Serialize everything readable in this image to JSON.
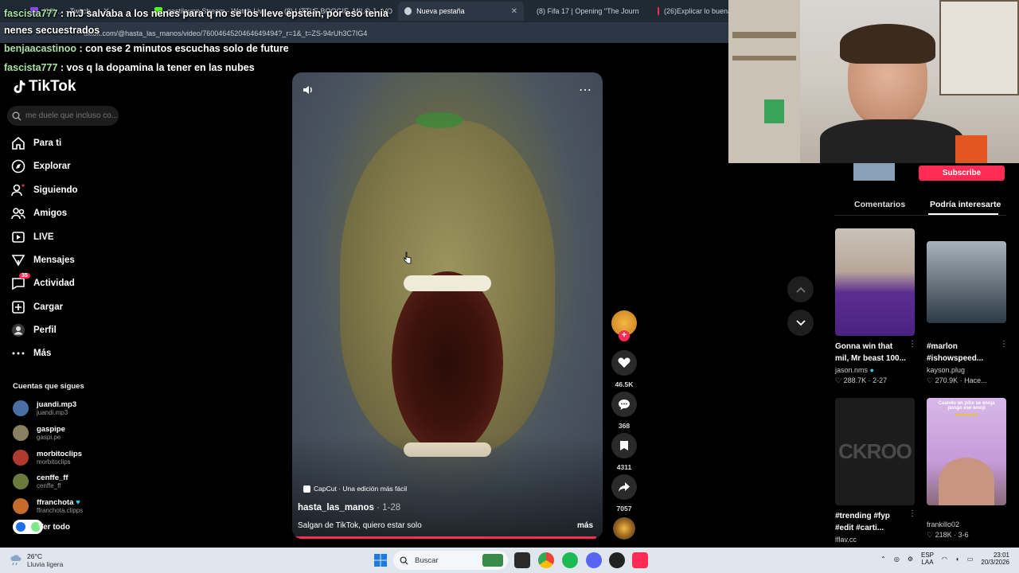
{
  "browser": {
    "tabs": [
      {
        "label": "(19) ... - Twitch",
        "color": "#9146ff"
      },
      {
        "label": "gastilounp Stream - Watch Liv",
        "color": "#53fc18"
      },
      {
        "label": "(8) LITTLE BOOGIE, MILO J - VO",
        "color": "#ff0033"
      },
      {
        "label": "Nueva pestaña",
        "color": "#c8d0d8"
      },
      {
        "label": "(8) Fifa 17 | Opening \"The Journ",
        "color": "#ff0033"
      },
      {
        "label": "(26)Explicar lo buena",
        "color": "#fe2c55"
      }
    ],
    "url": "tiktok.com/@hasta_las_manos/video/7600464520464649494?_r=1&_t=ZS-94rUh3C7IG4"
  },
  "chat": [
    {
      "user": "fascista777",
      "text": " : m.J salvaba a los nenes para q no se los lleve epstein, por eso tenia"
    },
    {
      "user": "",
      "text": "nenes secuestrados"
    },
    {
      "user": "benjaacastinoo",
      "text": " : con ese 2 minutos escuchas solo de future"
    },
    {
      "user": "fascista777",
      "text": " : vos q la dopamina la tener en las nubes"
    }
  ],
  "sidebar": {
    "logo": "TikTok",
    "search_placeholder": "me duele que incluso co...",
    "nav": [
      {
        "label": "Para ti",
        "icon": "home-icon"
      },
      {
        "label": "Explorar",
        "icon": "compass-icon"
      },
      {
        "label": "Siguiendo",
        "icon": "following-icon"
      },
      {
        "label": "Amigos",
        "icon": "friends-icon"
      },
      {
        "label": "LIVE",
        "icon": "live-icon"
      },
      {
        "label": "Mensajes",
        "icon": "messages-icon"
      },
      {
        "label": "Actividad",
        "icon": "activity-icon",
        "badge": "35"
      },
      {
        "label": "Cargar",
        "icon": "upload-icon"
      },
      {
        "label": "Perfil",
        "icon": "profile-icon"
      },
      {
        "label": "Más",
        "icon": "more-icon"
      }
    ],
    "following_title": "Cuentas que sigues",
    "accounts": [
      {
        "name": "juandi.mp3",
        "handle": "juandi.mp3",
        "color": "#4a6fa5"
      },
      {
        "name": "gaspipe",
        "handle": "gaspi.pe",
        "color": "#8a8062"
      },
      {
        "name": "morbitoclips",
        "handle": "morbitoclips",
        "color": "#b03a2e"
      },
      {
        "name": "cenffe_ff",
        "handle": "cenffe_ff",
        "color": "#6b7a3a"
      },
      {
        "name": "ffranchota",
        "handle": "ffranchota.clipps",
        "color": "#c46a2a",
        "verified": "♥"
      }
    ],
    "see_all": "Ver todo"
  },
  "video": {
    "capcut": "CapCut · Una edición más fácil",
    "author": "hasta_las_manos",
    "date": " · 1-28",
    "caption": "Salgan de TikTok, quiero estar solo",
    "more": "más",
    "progress": 0.98
  },
  "actions": {
    "likes": "46.5K",
    "comments": "368",
    "saves": "4311",
    "shares": "7057"
  },
  "right": {
    "subscribe": "Subscribe",
    "tab_comments": "Comentarios",
    "tab_suggest": "Podría interesarte",
    "cards": [
      {
        "title": "Gonna win that mil, Mr beast 100...",
        "user": "jason.nms",
        "stats": "♡ 288.7K · 2-27",
        "thumb": "#5b2d91"
      },
      {
        "title": "#marlon #ishowspeed...",
        "user": "kayson.plug",
        "stats": "♡ 270.9K · Hace...",
        "thumb": "#54606a"
      },
      {
        "title": "#trending #fyp #edit #carti...",
        "user": "lflav.cc",
        "stats": "",
        "thumb": "#1f1f1f"
      },
      {
        "title": "",
        "user": "frankillo02",
        "stats": "♡ 218K · 3-6",
        "thumb": "#c8a0d8"
      }
    ],
    "card4_overlay": "Cuando un pibe se enoja pongo ese emoji",
    "card3_overlay": "CKROO"
  },
  "taskbar": {
    "temp": "26°C",
    "weather": "Lluvia ligera",
    "search": "Buscar",
    "lang1": "ESP",
    "lang2": "LAA",
    "time": "23:01",
    "date": "20/3/2026"
  }
}
